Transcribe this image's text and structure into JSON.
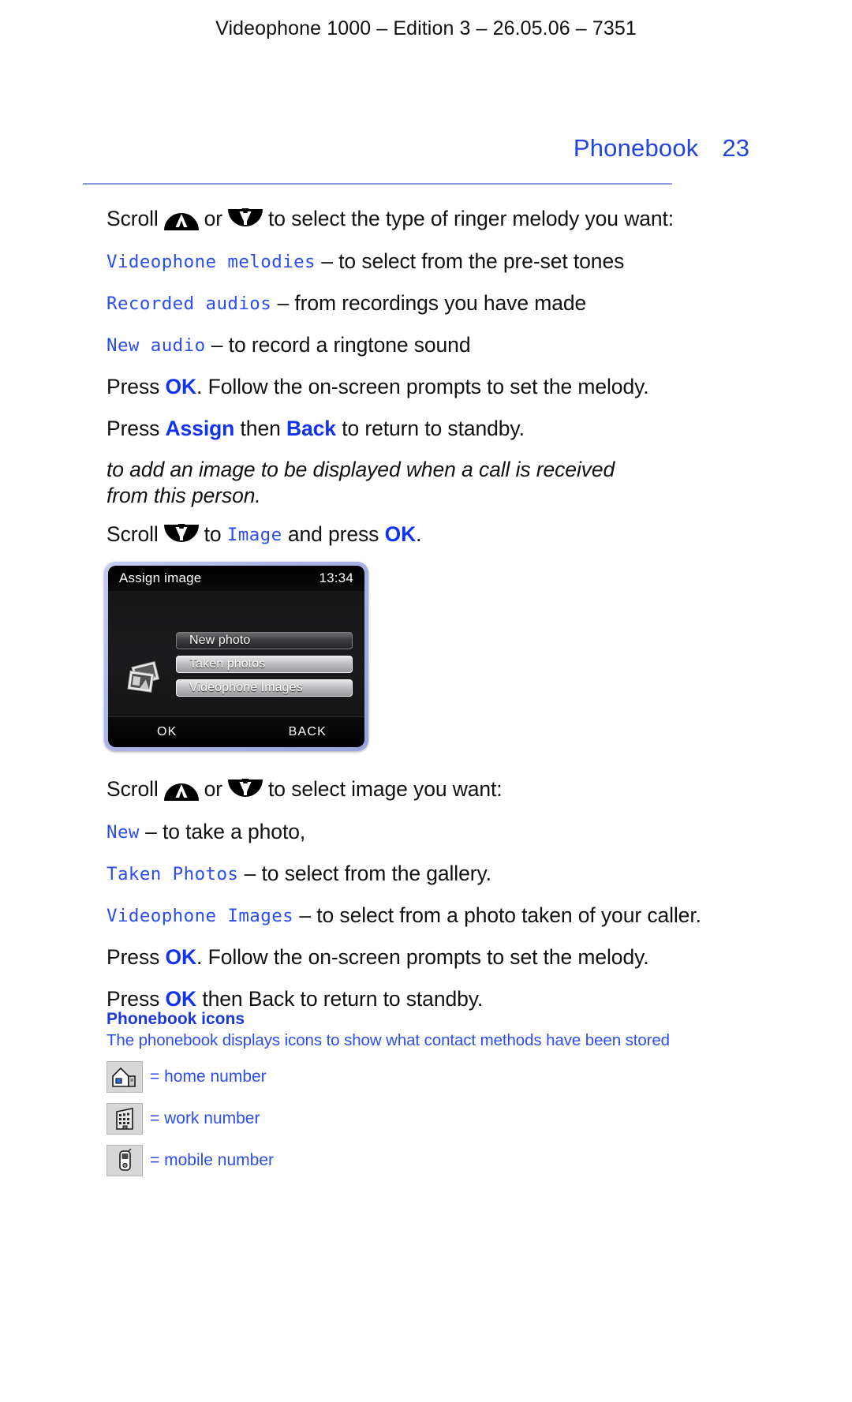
{
  "document": {
    "running_header": "Videophone 1000 – Edition 3 – 26.05.06 – 7351",
    "chapter": "Phonebook",
    "page_number": "23"
  },
  "colors": {
    "accent_blue": "#1133ee",
    "lcd_blue": "#2b4df0",
    "rule": "#8f9bdd"
  },
  "body": {
    "scroll_line_1": {
      "lead": "Scroll",
      "or": "or",
      "tail": "to select the type of ringer melody you want:"
    },
    "melody_options": [
      {
        "label": "Videophone melodies",
        "desc": "– to select from the pre-set tones"
      },
      {
        "label": "Recorded audios",
        "desc": "– from recordings you have made"
      },
      {
        "label": "New audio",
        "desc": "– to record a ringtone sound"
      }
    ],
    "press_ok_1": {
      "a": "Press ",
      "key": "OK",
      "b": ". Follow the on-screen prompts to set the melody."
    },
    "press_assign": {
      "a": "Press ",
      "key1": "Assign",
      "b": " then ",
      "key2": "Back",
      "c": " to return to standby."
    },
    "italic_note": "to add an image to be displayed when a call is received from this person.",
    "scroll_image_line": {
      "lead": "Scroll",
      "mid": "to",
      "label": "Image",
      "and": "and press",
      "key": "OK",
      "period": "."
    }
  },
  "phone_screen": {
    "title": "Assign image",
    "time": "13:34",
    "menu_items": [
      {
        "label": "New photo",
        "style": "dark"
      },
      {
        "label": "Taken photos",
        "style": "light"
      },
      {
        "label": "Videophone Images",
        "style": "light"
      }
    ],
    "softkey_left": "OK",
    "softkey_right": "BACK",
    "icon": "photos-stack-icon"
  },
  "body2": {
    "scroll_line_2": {
      "lead": "Scroll",
      "or": "or",
      "tail": "to select image you want:"
    },
    "image_options": [
      {
        "label": "New",
        "desc": "– to take a photo,"
      },
      {
        "label": "Taken Photos",
        "desc": "– to select from the gallery."
      },
      {
        "label": "Videophone Images",
        "desc": "– to select from a photo taken of your caller."
      }
    ],
    "press_ok_2": {
      "a": "Press ",
      "key": "OK",
      "b": ". Follow the on-screen prompts to set the melody."
    },
    "press_ok_3": {
      "a": "Press ",
      "key": "OK",
      "b": " then Back to return to standby."
    }
  },
  "phonebook_icons": {
    "heading": "Phonebook icons",
    "subtitle": "The phonebook displays icons to show what contact methods have been stored",
    "rows": [
      {
        "icon": "house-icon",
        "label": "= home number"
      },
      {
        "icon": "office-building-icon",
        "label": "= work number"
      },
      {
        "icon": "mobile-phone-icon",
        "label": "= mobile number"
      }
    ]
  }
}
